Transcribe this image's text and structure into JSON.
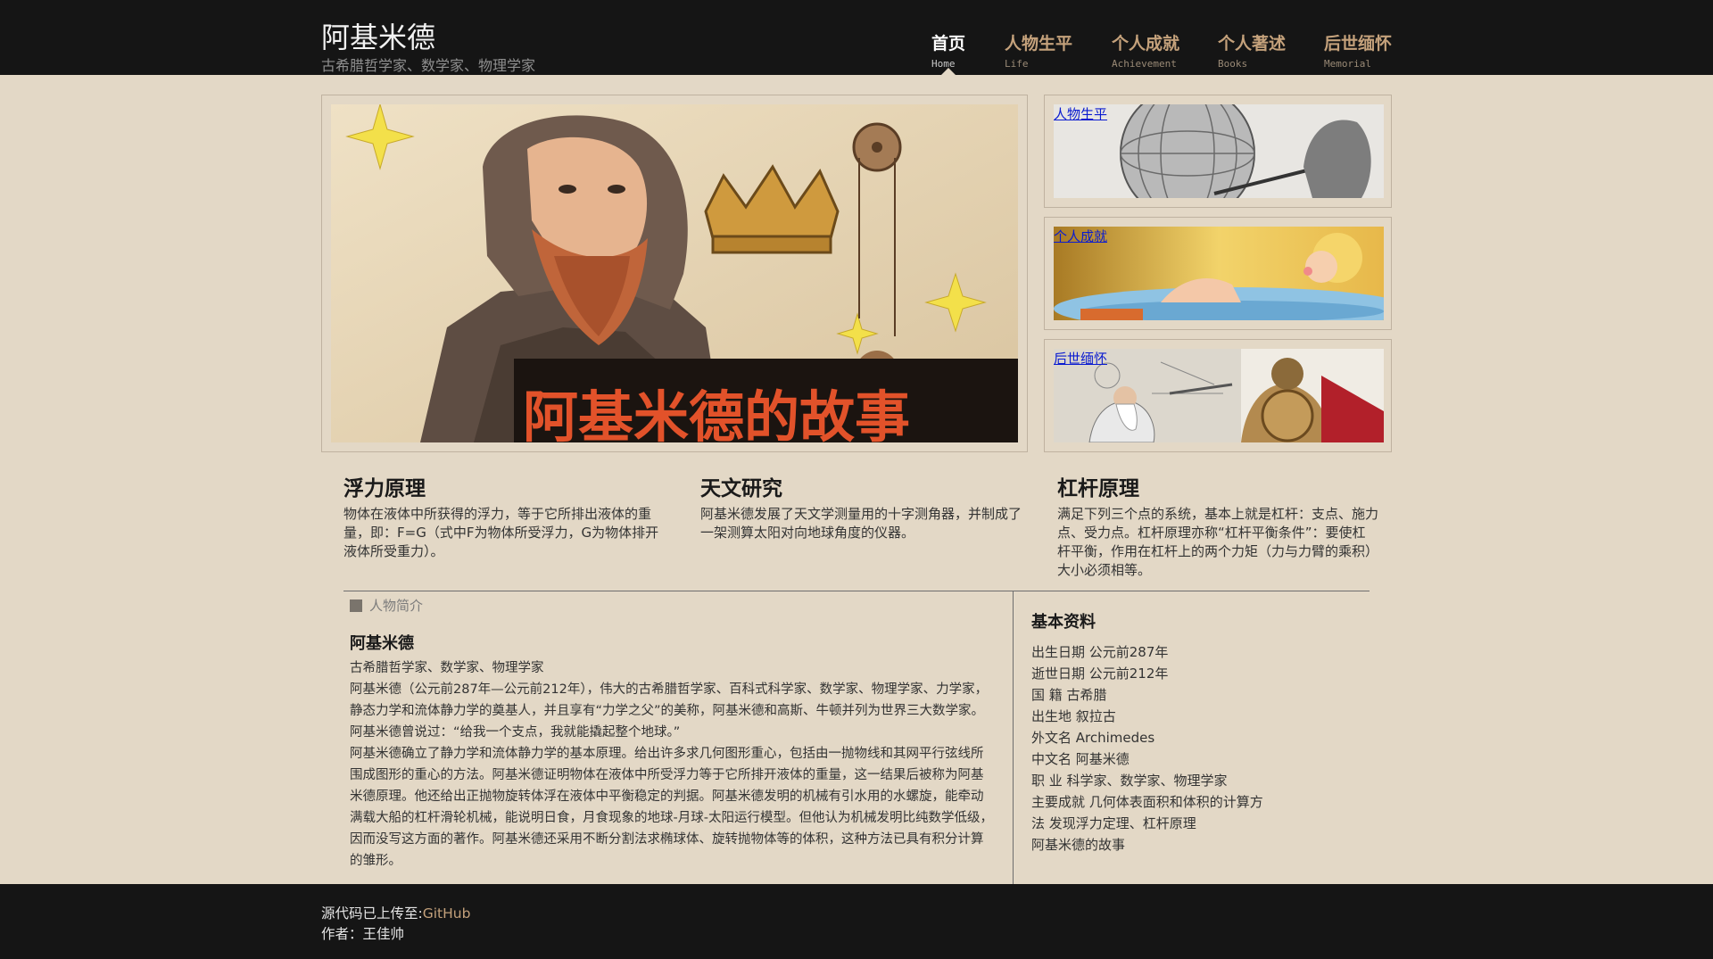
{
  "site": {
    "title": "阿基米德",
    "subtitle": "古希腊哲学家、数学家、物理学家"
  },
  "nav": [
    {
      "cn": "首页",
      "en": "Home",
      "active": true
    },
    {
      "cn": "人物生平",
      "en": "Life",
      "active": false
    },
    {
      "cn": "个人成就",
      "en": "Achievement",
      "active": false
    },
    {
      "cn": "个人著述",
      "en": "Books",
      "active": false
    },
    {
      "cn": "后世缅怀",
      "en": "Memorial",
      "active": false
    }
  ],
  "hero": {
    "title_text": "阿基米德的故事"
  },
  "side_panels": [
    {
      "label": "人物生平"
    },
    {
      "label": "个人成就"
    },
    {
      "label": "后世缅怀"
    }
  ],
  "features": [
    {
      "title": "浮力原理",
      "text": "物体在液体中所获得的浮力，等于它所排出液体的重量，即：F=G（式中F为物体所受浮力，G为物体排开液体所受重力）。"
    },
    {
      "title": "天文研究",
      "text": "阿基米德发展了天文学测量用的十字测角器，并制成了一架测算太阳对向地球角度的仪器。"
    },
    {
      "title": "杠杆原理",
      "text": "满足下列三个点的系统，基本上就是杠杆：支点、施力点、受力点。杠杆原理亦称“杠杆平衡条件”：要使杠杆平衡，作用在杠杆上的两个力矩（力与力臂的乘积）大小必须相等。"
    }
  ],
  "intro": {
    "section_label": "人物简介",
    "name": "阿基米德",
    "role": "古希腊哲学家、数学家、物理学家",
    "paragraph1": "阿基米德（公元前287年—公元前212年），伟大的古希腊哲学家、百科式科学家、数学家、物理学家、力学家，静态力学和流体静力学的奠基人，并且享有“力学之父”的美称，阿基米德和高斯、牛顿并列为世界三大数学家。阿基米德曾说过：“给我一个支点，我就能撬起整个地球。”",
    "paragraph2": "阿基米德确立了静力学和流体静力学的基本原理。给出许多求几何图形重心，包括由一抛物线和其网平行弦线所围成图形的重心的方法。阿基米德证明物体在液体中所受浮力等于它所排开液体的重量，这一结果后被称为阿基米德原理。他还给出正抛物旋转体浮在液体中平衡稳定的判据。阿基米德发明的机械有引水用的水螺旋，能牵动满载大船的杠杆滑轮机械，能说明日食，月食现象的地球-月球-太阳运行模型。但他认为机械发明比纯数学低级，因而没写这方面的著作。阿基米德还采用不断分割法求椭球体、旋转抛物体等的体积，这种方法已具有积分计算的雏形。"
  },
  "basic_info": {
    "title": "基本资料",
    "rows": [
      "出生日期 公元前287年",
      "逝世日期 公元前212年",
      "国 籍 古希腊",
      "出生地 叙拉古",
      "外文名 Archimedes",
      "中文名 阿基米德",
      "职 业 科学家、数学家、物理学家",
      "主要成就 几何体表面积和体积的计算方",
      "法 发现浮力定理、杠杆原理",
      "阿基米德的故事"
    ]
  },
  "footer": {
    "source_prefix": "源代码已上传至:",
    "source_link": "GitHub",
    "author": "作者：王佳帅"
  },
  "colors": {
    "page_bg": "#e3d8c6",
    "header_bg": "#151515",
    "nav_text": "#c4a17b",
    "link_blue": "#0a1bd0"
  }
}
